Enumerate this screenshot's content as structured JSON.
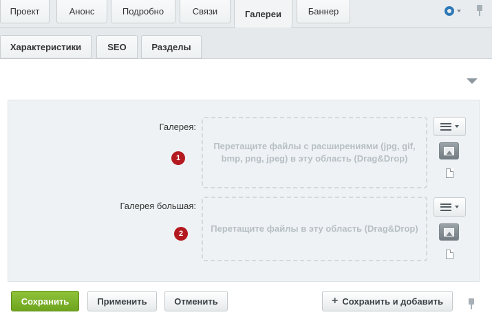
{
  "tabs_top": [
    {
      "label": "Проект",
      "active": false
    },
    {
      "label": "Анонс",
      "active": false
    },
    {
      "label": "Подробно",
      "active": false
    },
    {
      "label": "Связи",
      "active": false
    },
    {
      "label": "Галереи",
      "active": true
    },
    {
      "label": "Баннер",
      "active": false
    }
  ],
  "tabs_second": [
    {
      "label": "Характеристики"
    },
    {
      "label": "SEO"
    },
    {
      "label": "Разделы"
    }
  ],
  "fields": [
    {
      "label": "Галерея:",
      "badge": "1",
      "dropzone_text": "Перетащите файлы с расширениями (jpg, gif, bmp, png, jpeg) в эту область (Drag&Drop)"
    },
    {
      "label": "Галерея большая:",
      "badge": "2",
      "dropzone_text": "Перетащите файлы в эту область (Drag&Drop)"
    }
  ],
  "buttons": {
    "save": "Сохранить",
    "apply": "Применить",
    "cancel": "Отменить",
    "save_add": "Сохранить и добавить"
  },
  "colors": {
    "accent_blue": "#2f78b7",
    "save_green": "#7ab32b",
    "badge_red": "#b3191f"
  },
  "icons": {
    "settings": "gear-icon",
    "pin": "pin-icon",
    "collapse": "triangle-down-icon",
    "menu": "hamburger-menu-icon",
    "image": "image-icon",
    "file": "file-icon",
    "add": "plus-icon"
  }
}
